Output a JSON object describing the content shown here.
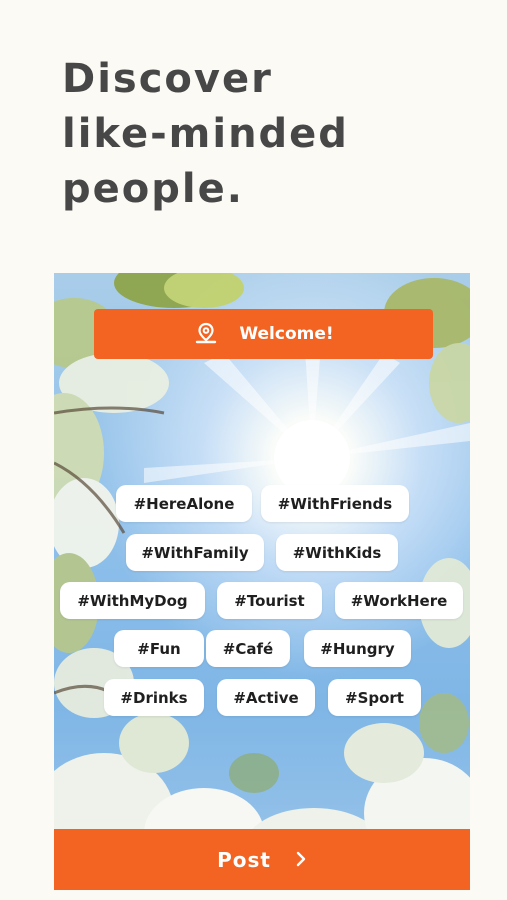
{
  "headline": {
    "line1": "Discover",
    "line2": "like-minded",
    "line3": "people."
  },
  "welcome": {
    "label": "Welcome!",
    "icon": "location-pin-icon"
  },
  "tags": [
    "#HereAlone",
    "#WithFriends",
    "#WithFamily",
    "#WithKids",
    "#WithMyDog",
    "#Tourist",
    "#WorkHere",
    "#Fun",
    "#Café",
    "#Hungry",
    "#Drinks",
    "#Active",
    "#Sport"
  ],
  "post": {
    "label": "Post",
    "icon": "chevron-right-icon"
  },
  "colors": {
    "accent": "#f36321",
    "background": "#fbfaf5",
    "headline": "#474747"
  }
}
